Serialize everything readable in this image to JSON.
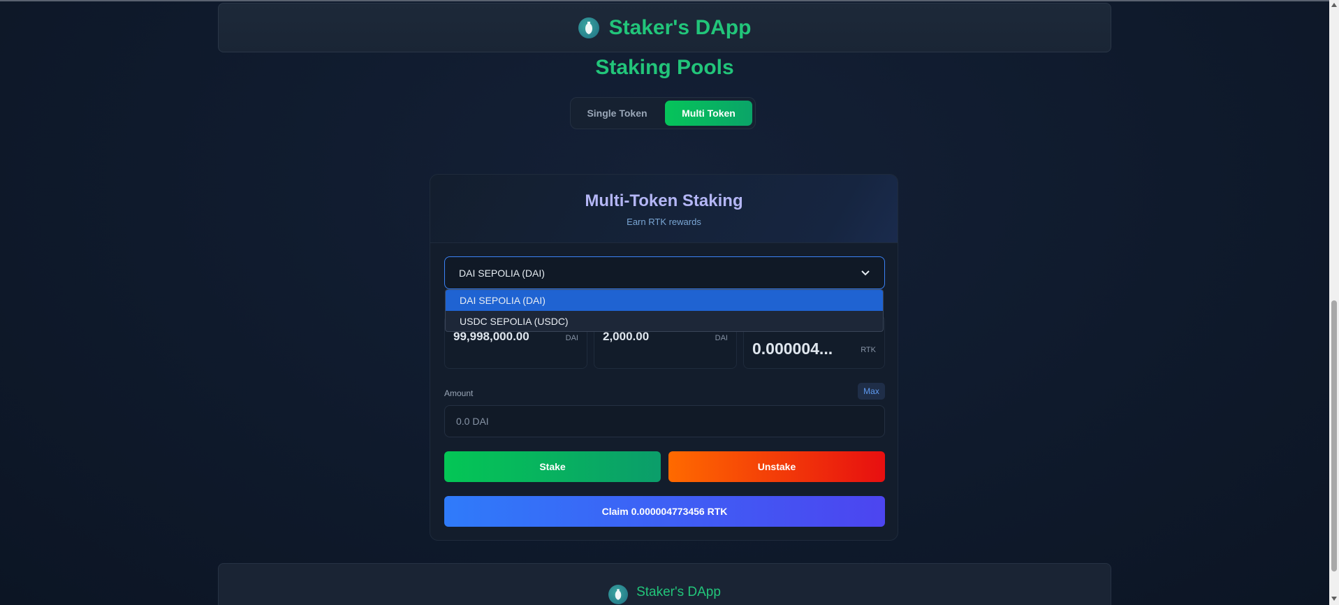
{
  "header": {
    "brand": "Staker's DApp",
    "logo_icon": "vase-icon"
  },
  "section": {
    "title": "Staking Pools"
  },
  "tabs": [
    {
      "label": "Single Token",
      "active": false
    },
    {
      "label": "Multi Token",
      "active": true
    }
  ],
  "card": {
    "title": "Multi-Token Staking",
    "subtitle": "Earn RTK rewards",
    "select": {
      "value": "DAI SEPOLIA (DAI)",
      "options": [
        "DAI SEPOLIA (DAI)",
        "USDC SEPOLIA (USDC)"
      ]
    },
    "stats": [
      {
        "value": "99,998,000.00",
        "unit": "DAI"
      },
      {
        "value": "2,000.00",
        "unit": "DAI"
      },
      {
        "value": "0.000004...",
        "unit": "RTK"
      }
    ],
    "amount": {
      "label": "Amount",
      "placeholder": "0.0 DAI",
      "max_label": "Max"
    },
    "buttons": {
      "stake": "Stake",
      "unstake": "Unstake",
      "claim": "Claim 0.000004773456 RTK"
    }
  },
  "footer": {
    "brand": "Staker's DApp"
  },
  "colors": {
    "brand_green": "#22c57a",
    "accent_blue": "#3b82f6",
    "unstake_red": "#e70f10"
  }
}
